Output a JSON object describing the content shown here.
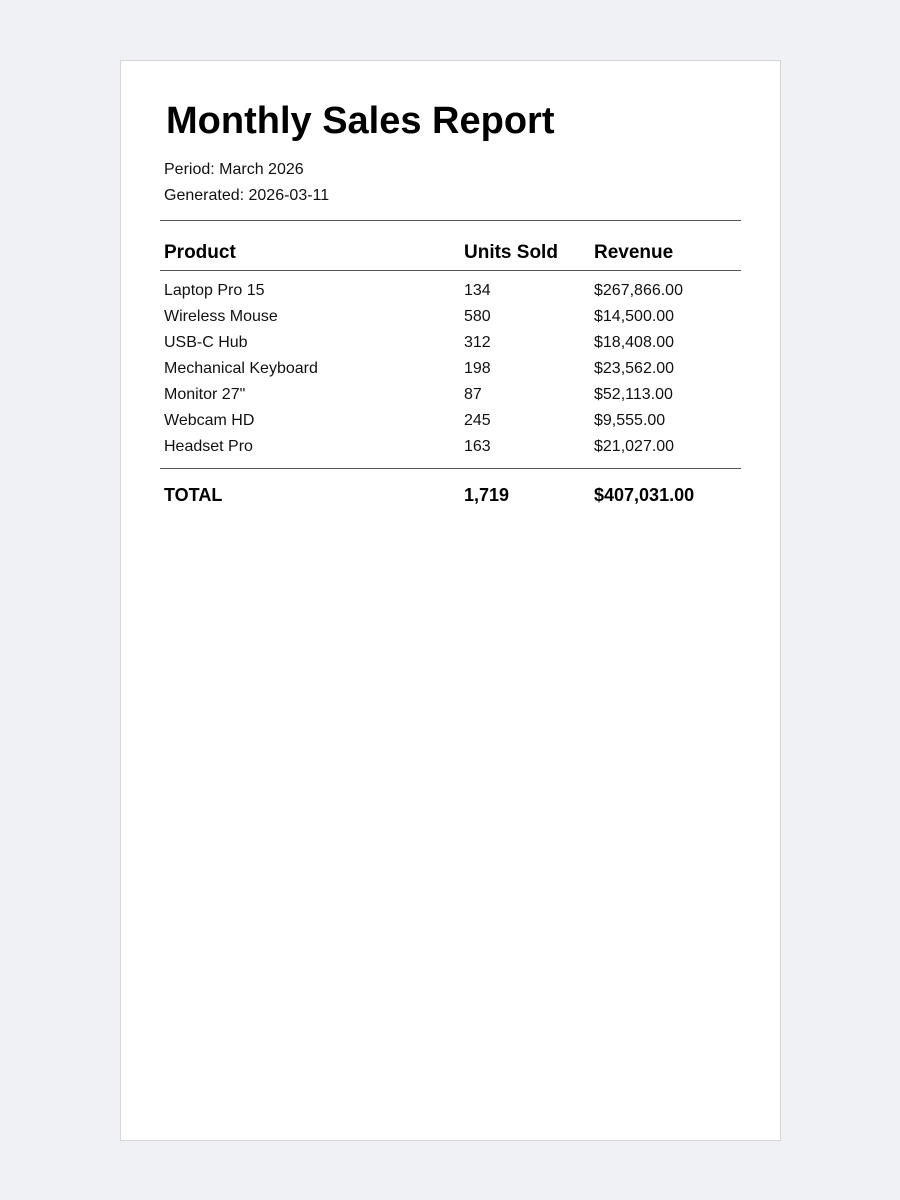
{
  "report": {
    "title": "Monthly Sales Report",
    "period": "Period: March 2026",
    "generated": "Generated: 2026-03-11"
  },
  "table": {
    "headers": {
      "product": "Product",
      "units": "Units Sold",
      "revenue": "Revenue"
    },
    "rows": [
      {
        "product": "Laptop Pro 15",
        "units": "134",
        "revenue": "$267,866.00"
      },
      {
        "product": "Wireless Mouse",
        "units": "580",
        "revenue": "$14,500.00"
      },
      {
        "product": "USB-C Hub",
        "units": "312",
        "revenue": "$18,408.00"
      },
      {
        "product": "Mechanical Keyboard",
        "units": "198",
        "revenue": "$23,562.00"
      },
      {
        "product": "Monitor 27\"",
        "units": "87",
        "revenue": "$52,113.00"
      },
      {
        "product": "Webcam HD",
        "units": "245",
        "revenue": "$9,555.00"
      },
      {
        "product": "Headset Pro",
        "units": "163",
        "revenue": "$21,027.00"
      }
    ],
    "total": {
      "label": "TOTAL",
      "units": "1,719",
      "revenue": "$407,031.00"
    }
  }
}
